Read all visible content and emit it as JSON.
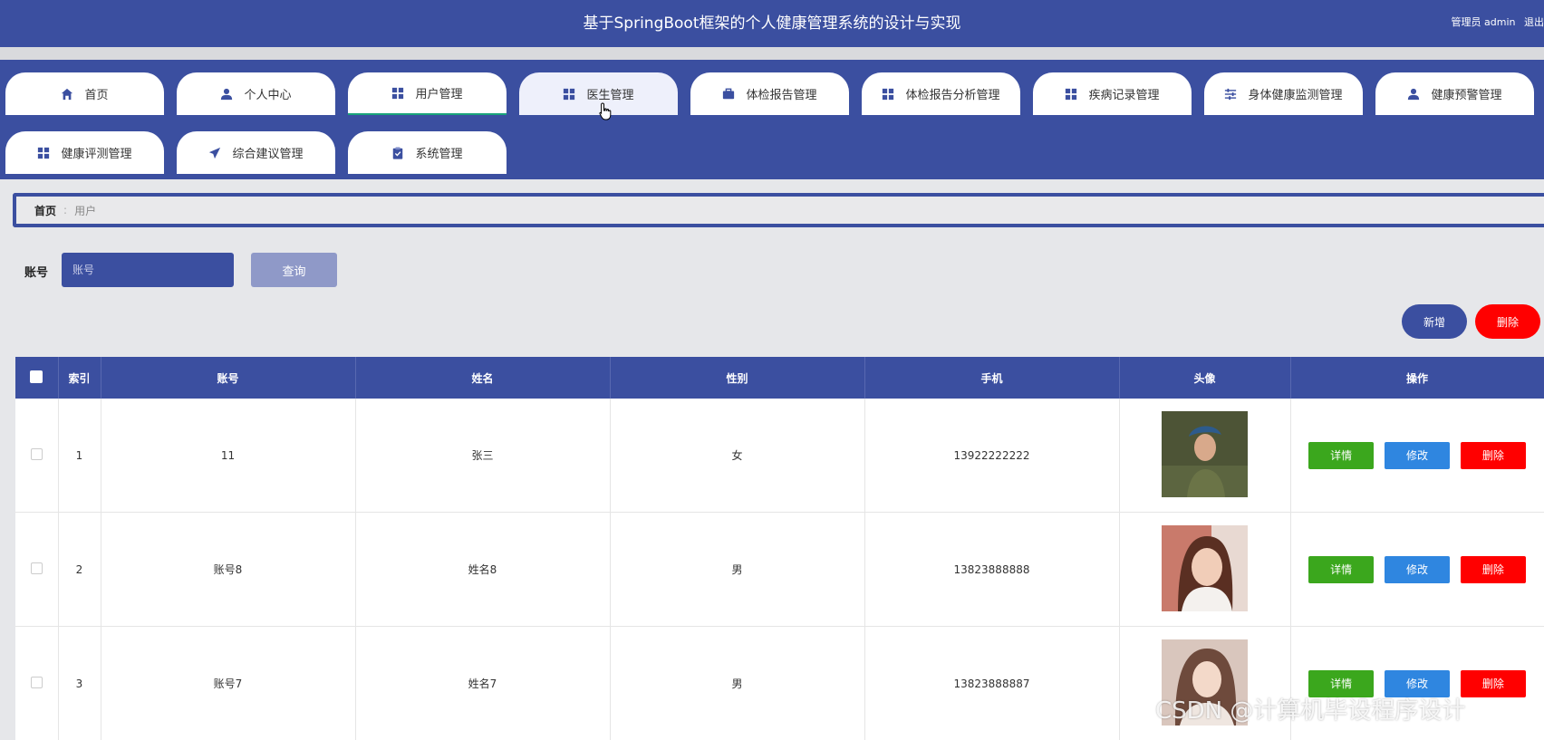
{
  "header": {
    "title": "基于SpringBoot框架的个人健康管理系统的设计与实现",
    "user_role": "管理员 admin",
    "logout": "退出"
  },
  "nav": {
    "tabs": [
      {
        "label": "首页",
        "icon": "home-icon"
      },
      {
        "label": "个人中心",
        "icon": "user-icon"
      },
      {
        "label": "用户管理",
        "icon": "grid-icon",
        "active": true
      },
      {
        "label": "医生管理",
        "icon": "grid-icon",
        "hover": true
      },
      {
        "label": "体检报告管理",
        "icon": "briefcase-icon"
      },
      {
        "label": "体检报告分析管理",
        "icon": "grid-icon"
      },
      {
        "label": "疾病记录管理",
        "icon": "grid-icon"
      },
      {
        "label": "身体健康监测管理",
        "icon": "sliders-icon"
      },
      {
        "label": "健康预警管理",
        "icon": "user-icon"
      },
      {
        "label": "健康评测管理",
        "icon": "grid-icon"
      },
      {
        "label": "综合建议管理",
        "icon": "send-icon"
      },
      {
        "label": "系统管理",
        "icon": "clipboard-icon"
      }
    ]
  },
  "breadcrumb": {
    "home": "首页",
    "separator": ":",
    "current": "用户"
  },
  "search": {
    "label": "账号",
    "placeholder": "账号",
    "button": "查询"
  },
  "actions": {
    "add": "新增",
    "delete": "删除"
  },
  "table": {
    "headers": [
      "索引",
      "账号",
      "姓名",
      "性别",
      "手机",
      "头像",
      "操作"
    ],
    "rows": [
      {
        "index": "1",
        "account": "11",
        "name": "张三",
        "gender": "女",
        "phone": "13922222222"
      },
      {
        "index": "2",
        "account": "账号8",
        "name": "姓名8",
        "gender": "男",
        "phone": "13823888888"
      },
      {
        "index": "3",
        "account": "账号7",
        "name": "姓名7",
        "gender": "男",
        "phone": "13823888887"
      }
    ],
    "ops": {
      "detail": "详情",
      "edit": "修改",
      "delete": "删除"
    }
  },
  "watermark": "CSDN @计算机毕设程序设计",
  "colors": {
    "primary": "#3b4fa0",
    "detail": "#3ba71d",
    "edit": "#2f86e0",
    "danger": "#ff0000"
  }
}
